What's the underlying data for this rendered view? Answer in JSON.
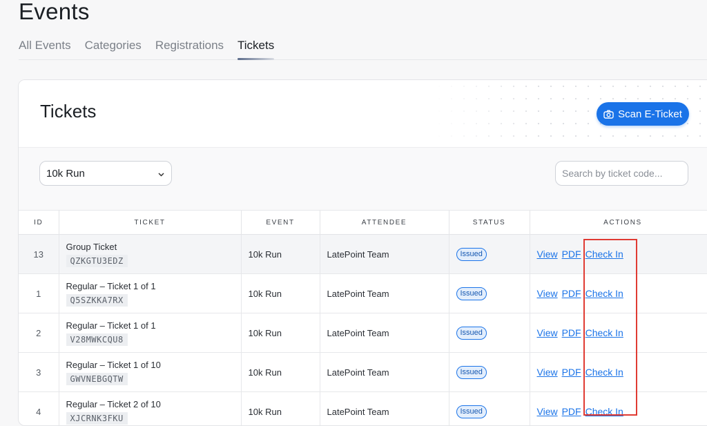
{
  "page": {
    "title": "Events"
  },
  "tabs": [
    {
      "label": "All Events"
    },
    {
      "label": "Categories"
    },
    {
      "label": "Registrations"
    },
    {
      "label": "Tickets"
    }
  ],
  "active_tab": "Tickets",
  "card": {
    "title": "Tickets",
    "scan_button": "Scan E-Ticket"
  },
  "filters": {
    "event_select": "10k Run",
    "search_placeholder": "Search by ticket code..."
  },
  "table": {
    "headers": [
      "ID",
      "TICKET",
      "EVENT",
      "ATTENDEE",
      "STATUS",
      "ACTIONS"
    ],
    "rows": [
      {
        "id": "13",
        "ticket": "Group Ticket",
        "code": "QZKGTU3EDZ",
        "event": "10k Run",
        "attendee": "LatePoint Team",
        "status": "Issued"
      },
      {
        "id": "1",
        "ticket": "Regular – Ticket 1 of 1",
        "code": "Q5SZKKA7RX",
        "event": "10k Run",
        "attendee": "LatePoint Team",
        "status": "Issued"
      },
      {
        "id": "2",
        "ticket": "Regular – Ticket 1 of 1",
        "code": "V28MWKCQU8",
        "event": "10k Run",
        "attendee": "LatePoint Team",
        "status": "Issued"
      },
      {
        "id": "3",
        "ticket": "Regular – Ticket 1 of 10",
        "code": "GWVNEBGQTW",
        "event": "10k Run",
        "attendee": "LatePoint Team",
        "status": "Issued"
      },
      {
        "id": "4",
        "ticket": "Regular – Ticket 2 of 10",
        "code": "XJCRNK3FKU",
        "event": "10k Run",
        "attendee": "LatePoint Team",
        "status": "Issued"
      }
    ],
    "actions": {
      "view": "View",
      "pdf": "PDF",
      "check_in": "Check In"
    }
  },
  "colors": {
    "accent": "#1a73e8",
    "highlight_box": "#e03a32"
  }
}
